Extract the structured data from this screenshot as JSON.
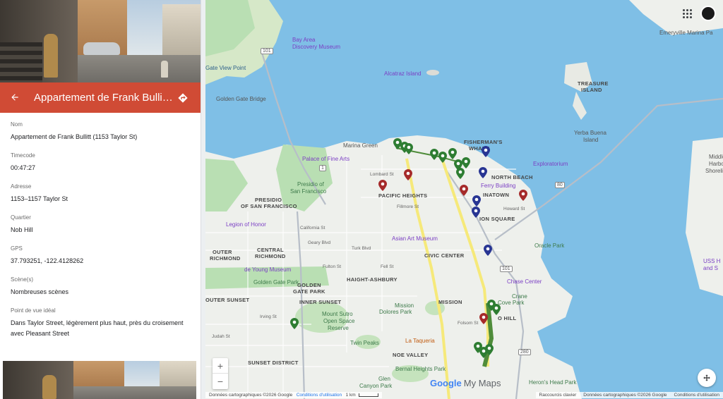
{
  "detail": {
    "title": "Appartement de Frank Bullitt ...",
    "fields": [
      {
        "label": "Nom",
        "value": "Appartement de Frank Bullitt (1153 Taylor St)"
      },
      {
        "label": "Timecode",
        "value": "00:47:27"
      },
      {
        "label": "Adresse",
        "value": "1153–1157 Taylor St"
      },
      {
        "label": "Quartier",
        "value": "Nob Hill"
      },
      {
        "label": "GPS",
        "value": "37.793251, -122.4128262"
      },
      {
        "label": "Scène(s)",
        "value": "Nombreuses scènes"
      },
      {
        "label": "Point de vue idéal",
        "value": "Dans Taylor Street, légèrement plus haut, près du croisement avec Pleasant Street"
      }
    ]
  },
  "map": {
    "labels": {
      "emeryville": "Emeryville Marina Pa",
      "bay_area": "Bay Area",
      "discovery": "Discovery Museum",
      "gate_view": "Gate View Point",
      "alcatraz": "Alcatraz Island",
      "treasure": "TREASURE",
      "island": "ISLAND",
      "golden_gate_bridge": "Golden Gate Bridge",
      "golden_gate": "Golden Gate",
      "yerba": "Yerba Buena",
      "yerba2": "Island",
      "marina_green": "Marina Green",
      "fishermans": "FISHERMAN'S",
      "wharf": "WHARF",
      "palace": "Palace of Fine Arts",
      "exploratorium": "Exploratorium",
      "north_beach": "NORTH BEACH",
      "presidio_sf": "Presidio of",
      "presidio_sf2": "San Francisco",
      "ferry": "Ferry Building",
      "chinatown": "INATOWN",
      "pacific_heights": "PACIFIC HEIGHTS",
      "presidio": "PRESIDIO",
      "presidio_sf3": "OF SAN FRANCISCO",
      "union_square": "ION SQUARE",
      "middle": "Middle",
      "harbor": "Harbor",
      "shoreline": "Shoreline",
      "legion": "Legion of Honor",
      "asian_art": "Asian Art Museum",
      "oracle": "Oracle Park",
      "outer_richmond": "OUTER",
      "outer_richmond2": "RICHMOND",
      "central_richmond": "CENTRAL",
      "central_richmond2": "RICHMOND",
      "civic_center": "CIVIC CENTER",
      "de_young": "de Young Museum",
      "golden_gate_park": "Golden Gate Park",
      "golden_gate_heights": "GOLDEN",
      "golden_gate_heights2": "GATE PARK",
      "haight": "HAIGHT-ASHBURY",
      "chase": "Chase Center",
      "uss": "USS H",
      "uss2": "and S",
      "outer_sunset": "OUTER SUNSET",
      "inner_sunset": "INNER SUNSET",
      "mission_dolores": "Mission",
      "mission_dolores2": "Dolores Park",
      "mission": "MISSION",
      "crane_cove": "Crane",
      "crane_cove2": "Cove Park",
      "potrero": "O HILL",
      "mount_sutro": "Mount Sutro",
      "open_space": "Open Space",
      "reserve": "Reserve",
      "twin_peaks": "Twin Peaks",
      "la_taqueria": "La Taqueria",
      "noe_valley": "NOE VALLEY",
      "sunset_district": "SUNSET DISTRICT",
      "bernal": "Bernal Heights Park",
      "herons": "Heron's Head Park",
      "glen": "Glen",
      "canyon": "Canyon Park",
      "fulton": "Fulton St",
      "california": "California St",
      "geary": "Geary Blvd",
      "turk": "Turk Blvd",
      "fell": "Fell St",
      "irving": "Irving St",
      "judah": "Judah St",
      "lombard": "Lombard St",
      "folsom": "Folsom St",
      "howard": "Howard St",
      "fillmore": "Fillmore St",
      "hwy101": "101",
      "hwy1": "1",
      "hwy80": "80",
      "hwy280": "280",
      "hwy101b": "101"
    },
    "logo_google": "Google",
    "logo_mymaps": "My Maps",
    "footer": {
      "attrib": "Données cartographiques ©2026 Google",
      "terms": "Conditions d'utilisation",
      "scale": "1 km",
      "shortcuts": "Raccourcis clavier",
      "attrib2": "Données cartographiques ©2026 Google",
      "terms2": "Conditions d'utilisation"
    },
    "zoom_in": "+",
    "zoom_out": "−",
    "colors": {
      "red_pin": "#a52a2a",
      "green_pin": "#2e7d32",
      "blue_pin": "#283593",
      "route_yellow": "#f6e97a",
      "route_green": "#4f8c3a",
      "water": "#7fbfe6",
      "land": "#eef0ec",
      "park": "#b9dfb3"
    }
  }
}
